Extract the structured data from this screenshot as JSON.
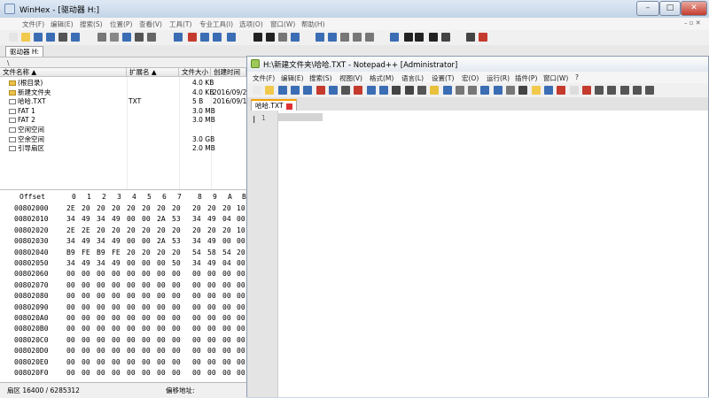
{
  "winhex": {
    "title": "WinHex - [驱动器 H:]",
    "menu": [
      "文件(F)",
      "编辑(E)",
      "搜索(S)",
      "位置(P)",
      "查看(V)",
      "工具(T)",
      "专业工具(I)",
      "选项(O)",
      "窗口(W)",
      "帮助(H)"
    ],
    "tab": "驱动器 H:",
    "path": "\\",
    "columns": [
      "文件名称 ▲",
      "扩展名 ▲",
      "文件大小",
      "创建时间"
    ],
    "files": [
      {
        "name": "(根目录)",
        "ext": "",
        "size": "4.0 KB",
        "created": "",
        "icon": "folder"
      },
      {
        "name": "新建文件夹",
        "ext": "",
        "size": "4.0 KB",
        "created": "2016/09/2",
        "icon": "folder"
      },
      {
        "name": "哈哈.TXT",
        "ext": "TXT",
        "size": "5 B",
        "created": "2016/09/1",
        "icon": "file"
      },
      {
        "name": "FAT 1",
        "ext": "",
        "size": "3.0 MB",
        "created": "",
        "icon": "file"
      },
      {
        "name": "FAT 2",
        "ext": "",
        "size": "3.0 MB",
        "created": "",
        "icon": "file"
      },
      {
        "name": "空闲空间",
        "ext": "",
        "size": "",
        "created": "",
        "icon": "file"
      },
      {
        "name": "空余空间",
        "ext": "",
        "size": "3.0 GB",
        "created": "",
        "icon": "file"
      },
      {
        "name": "引导扇区",
        "ext": "",
        "size": "2.0 MB",
        "created": "",
        "icon": "file"
      }
    ],
    "hex_header": [
      "Offset",
      "0",
      "1",
      "2",
      "3",
      "4",
      "5",
      "6",
      "7",
      "8",
      "9",
      "A",
      "B"
    ],
    "hex_rows": [
      {
        "offset": "00802000",
        "bytes": [
          "2E",
          "20",
          "20",
          "20",
          "20",
          "20",
          "20",
          "20",
          "20",
          "20",
          "20",
          "10"
        ]
      },
      {
        "offset": "00802010",
        "bytes": [
          "34",
          "49",
          "34",
          "49",
          "00",
          "00",
          "2A",
          "53",
          "34",
          "49",
          "04",
          "00"
        ]
      },
      {
        "offset": "00802020",
        "bytes": [
          "2E",
          "2E",
          "20",
          "20",
          "20",
          "20",
          "20",
          "20",
          "20",
          "20",
          "20",
          "10"
        ]
      },
      {
        "offset": "00802030",
        "bytes": [
          "34",
          "49",
          "34",
          "49",
          "00",
          "00",
          "2A",
          "53",
          "34",
          "49",
          "00",
          "00"
        ]
      },
      {
        "offset": "00802040",
        "bytes": [
          "B9",
          "FE",
          "B9",
          "FE",
          "20",
          "20",
          "20",
          "20",
          "54",
          "58",
          "54",
          "20"
        ]
      },
      {
        "offset": "00802050",
        "bytes": [
          "34",
          "49",
          "34",
          "49",
          "00",
          "00",
          "00",
          "50",
          "34",
          "49",
          "04",
          "00"
        ]
      },
      {
        "offset": "00802060",
        "bytes": [
          "00",
          "00",
          "00",
          "00",
          "00",
          "00",
          "00",
          "00",
          "00",
          "00",
          "00",
          "00"
        ]
      },
      {
        "offset": "00802070",
        "bytes": [
          "00",
          "00",
          "00",
          "00",
          "00",
          "00",
          "00",
          "00",
          "00",
          "00",
          "00",
          "00"
        ]
      },
      {
        "offset": "00802080",
        "bytes": [
          "00",
          "00",
          "00",
          "00",
          "00",
          "00",
          "00",
          "00",
          "00",
          "00",
          "00",
          "00"
        ]
      },
      {
        "offset": "00802090",
        "bytes": [
          "00",
          "00",
          "00",
          "00",
          "00",
          "00",
          "00",
          "00",
          "00",
          "00",
          "00",
          "00"
        ]
      },
      {
        "offset": "008020A0",
        "bytes": [
          "00",
          "00",
          "00",
          "00",
          "00",
          "00",
          "00",
          "00",
          "00",
          "00",
          "00",
          "00"
        ]
      },
      {
        "offset": "008020B0",
        "bytes": [
          "00",
          "00",
          "00",
          "00",
          "00",
          "00",
          "00",
          "00",
          "00",
          "00",
          "00",
          "00"
        ]
      },
      {
        "offset": "008020C0",
        "bytes": [
          "00",
          "00",
          "00",
          "00",
          "00",
          "00",
          "00",
          "00",
          "00",
          "00",
          "00",
          "00"
        ]
      },
      {
        "offset": "008020D0",
        "bytes": [
          "00",
          "00",
          "00",
          "00",
          "00",
          "00",
          "00",
          "00",
          "00",
          "00",
          "00",
          "00"
        ]
      },
      {
        "offset": "008020E0",
        "bytes": [
          "00",
          "00",
          "00",
          "00",
          "00",
          "00",
          "00",
          "00",
          "00",
          "00",
          "00",
          "00"
        ]
      },
      {
        "offset": "008020F0",
        "bytes": [
          "00",
          "00",
          "00",
          "00",
          "00",
          "00",
          "00",
          "00",
          "00",
          "00",
          "00",
          "00"
        ]
      }
    ],
    "status_sector": "扇区 16400 / 6285312",
    "status_offset": "偏移地址:"
  },
  "notepad": {
    "title": "H:\\新建文件夹\\哈哈.TXT - Notepad++ [Administrator]",
    "menu": [
      "文件(F)",
      "编辑(E)",
      "搜索(S)",
      "视图(V)",
      "格式(M)",
      "语言(L)",
      "设置(T)",
      "宏(O)",
      "运行(R)",
      "插件(P)",
      "窗口(W)",
      "?"
    ],
    "tab": "哈哈.TXT",
    "line_number": "1"
  },
  "colors": {
    "accent": "#f5a000",
    "close": "#c43b2e"
  }
}
